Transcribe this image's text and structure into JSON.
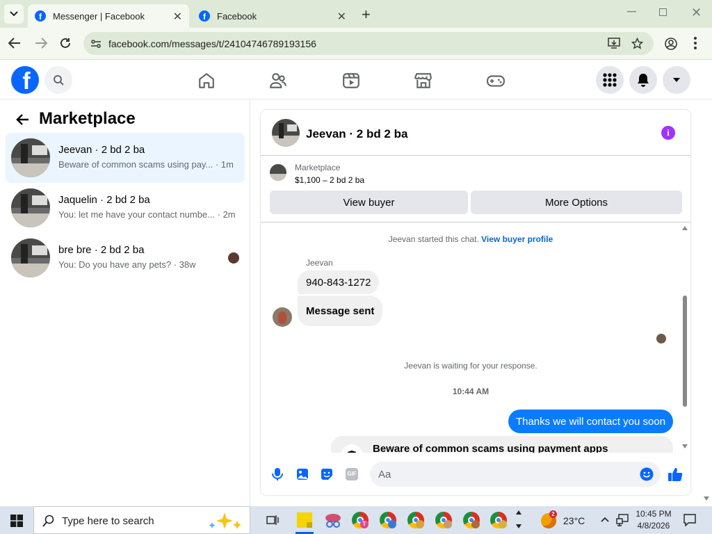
{
  "browser": {
    "tabs": [
      {
        "title": "Messenger | Facebook",
        "active": true
      },
      {
        "title": "Facebook",
        "active": false
      }
    ],
    "url": "facebook.com/messages/t/24104746789193156"
  },
  "fb": {
    "logo": "f"
  },
  "left": {
    "title": "Marketplace",
    "conversations": [
      {
        "name": "Jeevan · 2 bd 2 ba",
        "preview": "Beware of common scams using pay...",
        "time": "· 1m",
        "selected": true
      },
      {
        "name": "Jaquelin · 2 bd 2 ba",
        "preview": "You: let me have your contact numbe...",
        "time": "· 2m",
        "selected": false
      },
      {
        "name": "bre bre · 2 bd 2 ba",
        "preview": "You: Do you have any pets?",
        "time": "· 38w",
        "selected": false
      }
    ]
  },
  "chat": {
    "title": "Jeevan · 2 bd 2 ba",
    "listing_label": "Marketplace",
    "listing_price": "$1,100 – 2 bd 2 ba",
    "view_buyer": "View buyer",
    "more_options": "More Options",
    "started_text": "Jeevan started this chat.",
    "view_buyer_profile": "View buyer profile",
    "sender_name": "Jeevan",
    "msg1": "940-843-1272",
    "msg2": "Message sent",
    "waiting": "Jeevan is waiting for your response.",
    "timestamp": "10:44 AM",
    "my_msg": "Thanks we will contact you soon",
    "scam_title": "Beware of common scams using payment apps",
    "composer_placeholder": "Aa"
  },
  "taskbar": {
    "search_placeholder": "Type here to search",
    "weather": "23°C",
    "weather_badge": "2",
    "time": "10:45 PM",
    "date": "4/8/2026"
  },
  "colors": {
    "fb_blue": "#0866ff",
    "bubble_blue": "#0a7cff",
    "purple": "#a033ff",
    "selected": "#ebf5ff"
  }
}
